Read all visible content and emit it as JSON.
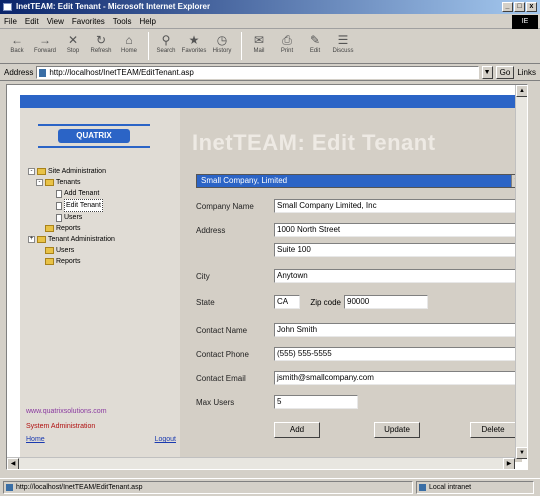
{
  "window": {
    "title": "InetTEAM: Edit Tenant - Microsoft Internet Explorer",
    "controls": [
      "_",
      "□",
      "x"
    ]
  },
  "menubar": {
    "items": [
      "File",
      "Edit",
      "View",
      "Favorites",
      "Tools",
      "Help"
    ],
    "logo": "IE"
  },
  "toolbar": {
    "buttons": [
      {
        "label": "Back",
        "icon": "back-arrow-icon",
        "glyph": "←"
      },
      {
        "label": "Forward",
        "icon": "forward-arrow-icon",
        "glyph": "→"
      },
      {
        "label": "Stop",
        "icon": "stop-icon",
        "glyph": "✕"
      },
      {
        "label": "Refresh",
        "icon": "refresh-icon",
        "glyph": "↻"
      },
      {
        "label": "Home",
        "icon": "home-icon",
        "glyph": "⌂"
      },
      {
        "label": "Search",
        "icon": "search-icon",
        "glyph": "⚲"
      },
      {
        "label": "Favorites",
        "icon": "favorites-icon",
        "glyph": "★"
      },
      {
        "label": "History",
        "icon": "history-icon",
        "glyph": "◷"
      },
      {
        "label": "Mail",
        "icon": "mail-icon",
        "glyph": "✉"
      },
      {
        "label": "Print",
        "icon": "print-icon",
        "glyph": "⎙"
      },
      {
        "label": "Edit",
        "icon": "edit-icon",
        "glyph": "✎"
      },
      {
        "label": "Discuss",
        "icon": "discuss-icon",
        "glyph": "☰"
      }
    ]
  },
  "address": {
    "label": "Address",
    "url": "http://localhost/InetTEAM/EditTenant.asp",
    "go_label": "Go",
    "links_label": "Links"
  },
  "app": {
    "logo_text": "QUATRIX",
    "heading": "InetTEAM: Edit Tenant",
    "tree": [
      {
        "label": "Site Administration",
        "level": 0,
        "kind": "folder",
        "expander": "-"
      },
      {
        "label": "Tenants",
        "level": 1,
        "kind": "folder",
        "expander": "-"
      },
      {
        "label": "Add Tenant",
        "level": 2,
        "kind": "doc"
      },
      {
        "label": "Edit Tenant",
        "level": 2,
        "kind": "doc",
        "selected": true
      },
      {
        "label": "Users",
        "level": 2,
        "kind": "doc"
      },
      {
        "label": "Reports",
        "level": 1,
        "kind": "folder"
      },
      {
        "label": "Tenant Administration",
        "level": 0,
        "kind": "folder",
        "expander": "+"
      },
      {
        "label": "Users",
        "level": 1,
        "kind": "folder"
      },
      {
        "label": "Reports",
        "level": 1,
        "kind": "folder"
      }
    ],
    "site_url": "www.quatrixsolutions.com",
    "role": "System Administration",
    "home_link": "Home",
    "logout_link": "Logout"
  },
  "form": {
    "tenant_selected": "Small Company, Limited",
    "fields": {
      "company_name": {
        "label": "Company Name",
        "value": "Small Company Limited, Inc"
      },
      "address": {
        "label": "Address",
        "value": "1000 North Street"
      },
      "address2": {
        "label": "",
        "value": "Suite 100"
      },
      "city": {
        "label": "City",
        "value": "Anytown"
      },
      "state": {
        "label": "State",
        "value": "CA"
      },
      "zip": {
        "label": "Zip code",
        "value": "90000"
      },
      "contact_name": {
        "label": "Contact Name",
        "value": "John Smith"
      },
      "contact_phone": {
        "label": "Contact Phone",
        "value": "(555) 555-5555"
      },
      "contact_email": {
        "label": "Contact Email",
        "value": "jsmith@smallcompany.com"
      },
      "num_users": {
        "label": "Max Users",
        "value": "5"
      }
    },
    "buttons": {
      "add": "Add",
      "update": "Update",
      "delete": "Delete"
    }
  },
  "status": {
    "text": "http://localhost/InetTEAM/EditTenant.asp",
    "zone": "Local intranet"
  }
}
